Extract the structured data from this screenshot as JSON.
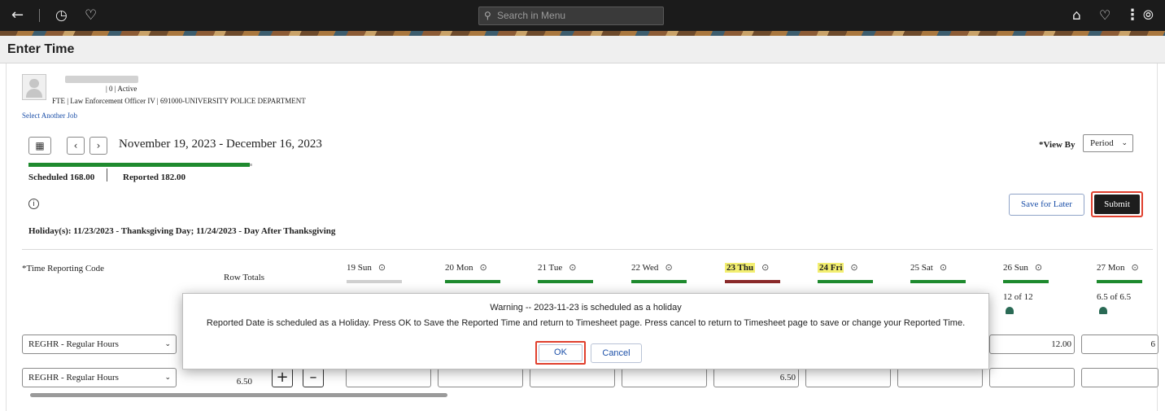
{
  "topbar": {
    "search_placeholder": "Search in Menu",
    "icons": [
      "back-arrow-icon",
      "history-icon",
      "favorites-heart-icon",
      "home-icon",
      "notifications-bell-icon",
      "actions-menu-icon",
      "navbar-compass-icon"
    ]
  },
  "page": {
    "title": "Enter Time"
  },
  "employee": {
    "status": "| 0 | Active",
    "job": "FTE | Law Enforcement Officer IV | 691000-UNIVERSITY POLICE DEPARTMENT",
    "select_job_link": "Select Another Job"
  },
  "period": {
    "date_range": "November 19, 2023 - December 16, 2023",
    "view_by_label": "*View By",
    "view_by_value": "Period",
    "progress_fraction": 1.0
  },
  "summary": {
    "scheduled": "Scheduled  168.00",
    "reported": "Reported  182.00"
  },
  "actions": {
    "save_for_later": "Save for Later",
    "submit": "Submit"
  },
  "holiday_text": "Holiday(s): 11/23/2023 - Thanksgiving Day; 11/24/2023 - Day After Thanksgiving",
  "grid": {
    "trc_header": "*Time Reporting Code",
    "row_totals_header": "Row Totals",
    "days": [
      {
        "label": "19 Sun",
        "holiday": false,
        "bar": "#d0d0d0",
        "sub": ""
      },
      {
        "label": "20 Mon",
        "holiday": false,
        "bar": "#1e8a2e",
        "sub": ""
      },
      {
        "label": "21 Tue",
        "holiday": false,
        "bar": "#1e8a2e",
        "sub": ""
      },
      {
        "label": "22 Wed",
        "holiday": false,
        "bar": "#1e8a2e",
        "sub": ""
      },
      {
        "label": "23 Thu",
        "holiday": true,
        "bar": "#8a2a2a",
        "sub": ""
      },
      {
        "label": "24 Fri",
        "holiday": true,
        "bar": "#1e8a2e",
        "sub": ""
      },
      {
        "label": "25 Sat",
        "holiday": false,
        "bar": "#1e8a2e",
        "sub": ""
      },
      {
        "label": "26 Sun",
        "holiday": false,
        "bar": "#1e8a2e",
        "sub": "12 of 12"
      },
      {
        "label": "27 Mon",
        "holiday": false,
        "bar": "#1e8a2e",
        "sub": "6.5 of 6.5"
      }
    ],
    "rows": [
      {
        "trc": "REGHR - Regular Hours",
        "total": "",
        "cells": [
          "",
          "",
          "",
          "",
          "",
          "",
          "",
          "12.00",
          "6"
        ]
      },
      {
        "trc": "REGHR - Regular Hours",
        "total": "6.50",
        "cells": [
          "",
          "",
          "",
          "",
          "6.50",
          "",
          "",
          "",
          ""
        ]
      }
    ]
  },
  "modal": {
    "title": "Warning -- 2023-11-23 is scheduled as  a holiday",
    "message": "Reported Date is scheduled as a Holiday. Press OK to Save the Reported Time and return to Timesheet page. Press cancel to return to Timesheet page to save or change your Reported Time.",
    "ok": "OK",
    "cancel": "Cancel"
  }
}
